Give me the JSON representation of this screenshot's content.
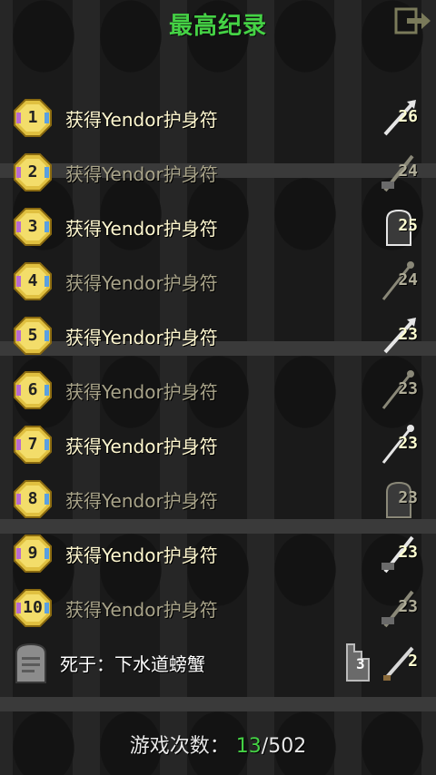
{
  "header": {
    "title": "最高纪录",
    "exit_icon": "exit-icon"
  },
  "records": [
    {
      "rank": "1",
      "description": "获得Yendor护身符",
      "level": "26",
      "bright": true,
      "hero": "warrior"
    },
    {
      "rank": "2",
      "description": "获得Yendor护身符",
      "level": "24",
      "bright": false,
      "hero": "mage"
    },
    {
      "rank": "3",
      "description": "获得Yendor护身符",
      "level": "25",
      "bright": true,
      "hero": "rogue"
    },
    {
      "rank": "4",
      "description": "获得Yendor护身符",
      "level": "24",
      "bright": false,
      "hero": "huntress"
    },
    {
      "rank": "5",
      "description": "获得Yendor护身符",
      "level": "23",
      "bright": true,
      "hero": "warrior"
    },
    {
      "rank": "6",
      "description": "获得Yendor护身符",
      "level": "23",
      "bright": false,
      "hero": "huntress"
    },
    {
      "rank": "7",
      "description": "获得Yendor护身符",
      "level": "23",
      "bright": true,
      "hero": "huntress"
    },
    {
      "rank": "8",
      "description": "获得Yendor护身符",
      "level": "23",
      "bright": false,
      "hero": "rogue"
    },
    {
      "rank": "9",
      "description": "获得Yendor护身符",
      "level": "23",
      "bright": true,
      "hero": "mage"
    },
    {
      "rank": "10",
      "description": "获得Yendor护身符",
      "level": "23",
      "bright": false,
      "hero": "mage"
    }
  ],
  "latest": {
    "description": "死于：下水道螃蟹",
    "depth": "3",
    "level": "2",
    "icon": "tombstone-icon"
  },
  "footer": {
    "label": "游戏次数：",
    "won": "13",
    "total": "/502"
  },
  "colors": {
    "accent": "#45d245",
    "bright_text": "#fff8d0",
    "dim_text": "#a9a48a"
  }
}
